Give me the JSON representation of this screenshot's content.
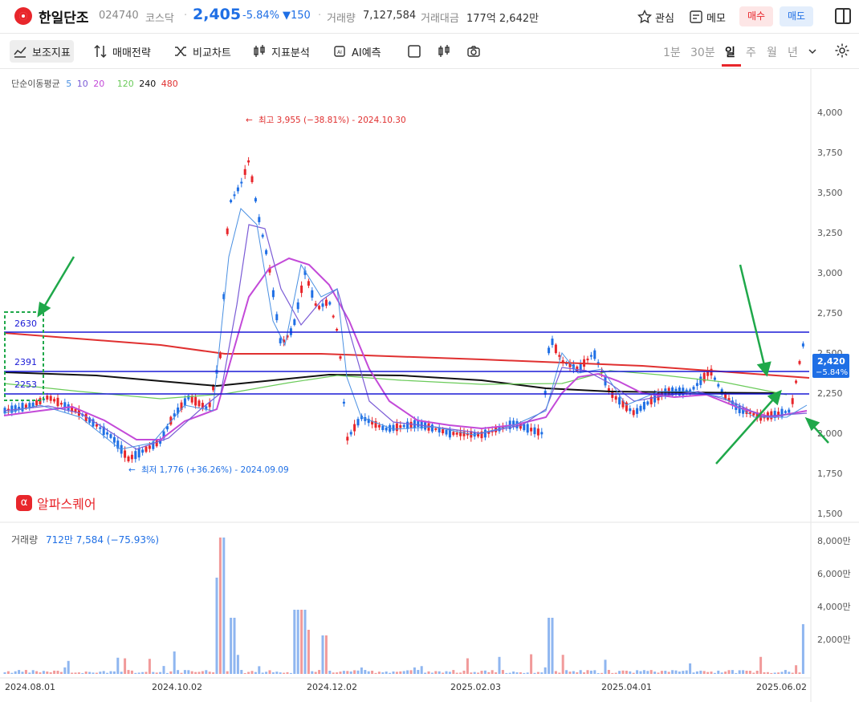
{
  "header": {
    "name": "한일단조",
    "code": "024740",
    "market": "코스닥",
    "price": "2,405",
    "change_pct": "-5.84%",
    "change": "▼150",
    "volume_label": "거래량",
    "volume": "7,127,584",
    "amount_label": "거래대금",
    "amount": "177억 2,642만",
    "interest": "관심",
    "memo": "메모",
    "buy": "매수",
    "sell": "매도"
  },
  "toolbar": {
    "items": [
      "보조지표",
      "매매전략",
      "비교차트",
      "지표분석",
      "AI예측"
    ],
    "periods": [
      "1분",
      "30분",
      "일",
      "주",
      "월",
      "년"
    ],
    "selected_period": "일"
  },
  "legend": {
    "title": "단순이동평균",
    "ma": [
      "5",
      "10",
      "20",
      "120",
      "240",
      "480"
    ],
    "ma_colors": [
      "#4a90e2",
      "#7b5cd6",
      "#c34ad8",
      "#6bcb5a",
      "#111111",
      "#e03030"
    ]
  },
  "watermark": "알파스퀘어",
  "price_chart": {
    "y_ticks": [
      "4,000",
      "3,750",
      "3,500",
      "3,250",
      "3,000",
      "2,750",
      "2,500",
      "2,250",
      "2,000",
      "1,750",
      "1,500"
    ],
    "x_ticks": [
      "2024.08.01",
      "2024.10.02",
      "2024.12.02",
      "2025.02.03",
      "2025.04.01",
      "2025.06.02"
    ],
    "high_annotation": "최고 3,955 (−38.81%) - 2024.10.30",
    "low_annotation": "최저 1,776 (+36.26%) - 2024.09.09",
    "hlines": [
      "2630",
      "2391",
      "2253"
    ],
    "last_price_tag": "2,420",
    "last_pct_tag": "−5.84%"
  },
  "volume_chart": {
    "label": "거래량",
    "value": "712만 7,584 (−75.93%)",
    "y_ticks": [
      "8,000만",
      "6,000만",
      "4,000만",
      "2,000만"
    ]
  }
}
